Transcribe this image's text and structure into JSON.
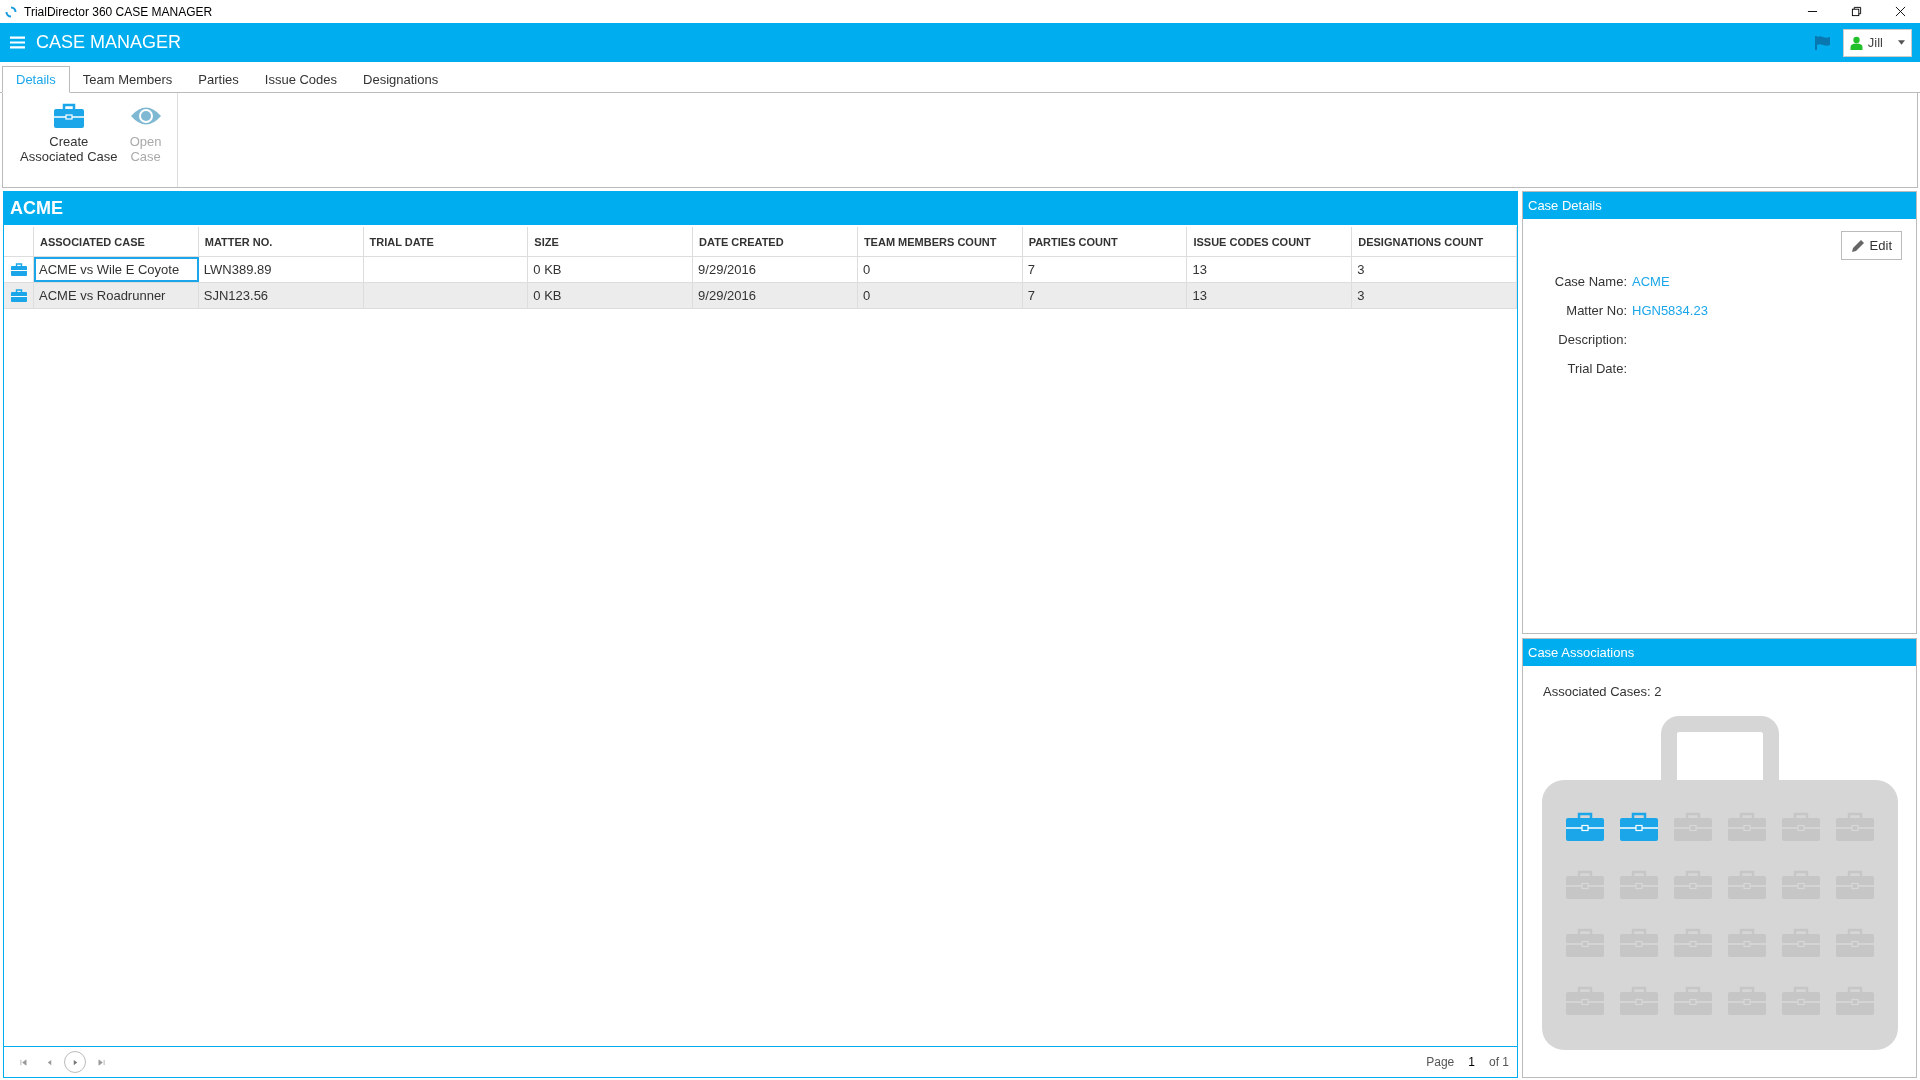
{
  "window": {
    "title": "TrialDirector 360 CASE MANAGER"
  },
  "header": {
    "title": "CASE MANAGER",
    "user": "Jill"
  },
  "tabs": [
    {
      "label": "Details",
      "selected": true
    },
    {
      "label": "Team Members",
      "selected": false
    },
    {
      "label": "Parties",
      "selected": false
    },
    {
      "label": "Issue Codes",
      "selected": false
    },
    {
      "label": "Designations",
      "selected": false
    }
  ],
  "ribbon": [
    {
      "kind": "case",
      "label": "Create\nAssociated Case",
      "disabled": false
    },
    {
      "kind": "eye",
      "label": "Open\nCase",
      "disabled": true
    }
  ],
  "table": {
    "title": "ACME",
    "columns": [
      "ASSOCIATED CASE",
      "MATTER NO.",
      "TRIAL DATE",
      "SIZE",
      "DATE CREATED",
      "TEAM MEMBERS COUNT",
      "PARTIES COUNT",
      "ISSUE CODES COUNT",
      "DESIGNATIONS COUNT"
    ],
    "rows": [
      {
        "focused": true,
        "cells": [
          "ACME vs Wile E Coyote",
          "LWN389.89",
          "",
          "0 KB",
          "9/29/2016",
          "0",
          "7",
          "13",
          "3"
        ]
      },
      {
        "focused": false,
        "cells": [
          "ACME vs Roadrunner",
          "SJN123.56",
          "",
          "0 KB",
          "9/29/2016",
          "0",
          "7",
          "13",
          "3"
        ]
      }
    ]
  },
  "pager": {
    "label": "Page",
    "page": "1",
    "of": "of 1"
  },
  "case_details": {
    "title": "Case Details",
    "edit": "Edit",
    "fields": [
      {
        "label": "Case Name:",
        "value": "ACME"
      },
      {
        "label": "Matter No:",
        "value": "HGN5834.23"
      },
      {
        "label": "Description:"
      },
      {
        "label": "Trial Date:"
      }
    ]
  },
  "case_associations": {
    "title": "Case Associations",
    "summary": "Associated Cases: 2",
    "slots": [
      {
        "filled": true
      },
      {
        "filled": true
      },
      {
        "filled": false
      },
      {
        "filled": false
      },
      {
        "filled": false
      },
      {
        "filled": false
      },
      {
        "filled": false
      },
      {
        "filled": false
      },
      {
        "filled": false
      },
      {
        "filled": false
      },
      {
        "filled": false
      },
      {
        "filled": false
      },
      {
        "filled": false
      },
      {
        "filled": false
      },
      {
        "filled": false
      },
      {
        "filled": false
      },
      {
        "filled": false
      },
      {
        "filled": false
      },
      {
        "filled": false
      },
      {
        "filled": false
      },
      {
        "filled": false
      },
      {
        "filled": false
      },
      {
        "filled": false
      },
      {
        "filled": false
      }
    ]
  }
}
